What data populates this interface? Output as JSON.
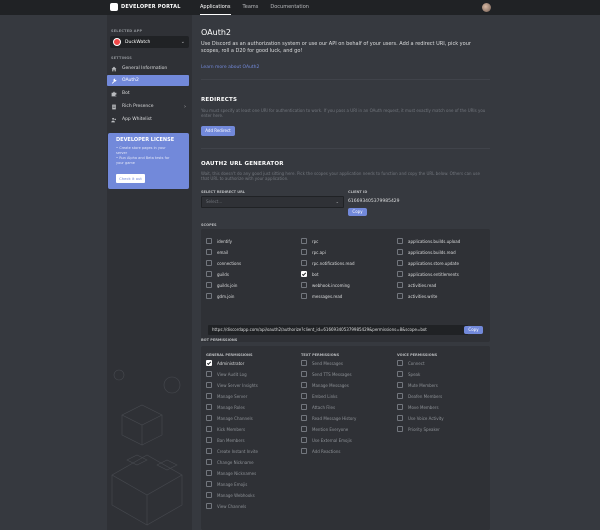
{
  "brand": "DEVELOPER PORTAL",
  "nav_tabs": [
    "Applications",
    "Teams",
    "Documentation"
  ],
  "sidebar": {
    "selected_app_label": "SELECTED APP",
    "app_name": "DuckWatch",
    "settings_label": "SETTINGS",
    "items": [
      {
        "label": "General Information"
      },
      {
        "label": "OAuth2"
      },
      {
        "label": "Bot"
      },
      {
        "label": "Rich Presence"
      },
      {
        "label": "App Whitelist"
      }
    ],
    "license": {
      "title": "DEVELOPER LICENSE",
      "bullets": [
        "Create store pages in your server",
        "Run Alpha and Beta tests for your game"
      ],
      "button": "Check it out"
    }
  },
  "main": {
    "title": "OAuth2",
    "description": "Use Discord as an authorization system or use our API on behalf of your users. Add a redirect URI, pick your scopes, roll a D20 for good luck, and go!",
    "learn_more": "Learn more about OAuth2",
    "redirects_title": "REDIRECTS",
    "redirects_help": "You must specify at least one URI for authentication to work. If you pass a URI in an OAuth request, it must exactly match one of the URIs you enter here.",
    "add_redirect": "Add Redirect",
    "generator_title": "OAUTH2 URL GENERATOR",
    "generator_help": "Wait, this doesn't do any good just sitting here. Pick the scopes your application needs to function and copy the URL below. Others can use that URL to authorize with your application.",
    "select_redirect_label": "SELECT REDIRECT URL",
    "select_placeholder": "Select...",
    "client_id_label": "CLIENT ID",
    "client_id": "616693405379985429",
    "copy": "Copy",
    "scopes_label": "SCOPES",
    "scopes": [
      [
        "identify",
        "rpc",
        "applications.builds.upload"
      ],
      [
        "email",
        "rpc.api",
        "applications.builds.read"
      ],
      [
        "connections",
        "rpc.notifications.read",
        "applications.store.update"
      ],
      [
        "guilds",
        "bot",
        "applications.entitlements"
      ],
      [
        "guilds.join",
        "webhook.incoming",
        "activities.read"
      ],
      [
        "gdm.join",
        "messages.read",
        "activities.write"
      ]
    ],
    "generated_url": "https://discordapp.com/api/oauth2/authorize?client_id=616693405379985429&permissions=8&scope=bot",
    "bot_permissions_label": "BOT PERMISSIONS",
    "perm_columns": [
      {
        "title": "GENERAL PERMISSIONS",
        "items": [
          "Administrator",
          "View Audit Log",
          "View Server Insights",
          "Manage Server",
          "Manage Roles",
          "Manage Channels",
          "Kick Members",
          "Ban Members",
          "Create Instant Invite",
          "Change Nickname",
          "Manage Nicknames",
          "Manage Emojis",
          "Manage Webhooks",
          "View Channels"
        ]
      },
      {
        "title": "TEXT PERMISSIONS",
        "items": [
          "Send Messages",
          "Send TTS Messages",
          "Manage Messages",
          "Embed Links",
          "Attach Files",
          "Read Message History",
          "Mention Everyone",
          "Use External Emojis",
          "Add Reactions"
        ]
      },
      {
        "title": "VOICE PERMISSIONS",
        "items": [
          "Connect",
          "Speak",
          "Mute Members",
          "Deafen Members",
          "Move Members",
          "Use Voice Activity",
          "Priority Speaker"
        ]
      }
    ]
  },
  "colors": {
    "accent": "#7289da",
    "background": "#36393f",
    "sidebar": "#2f3136",
    "topbar": "#202225"
  }
}
